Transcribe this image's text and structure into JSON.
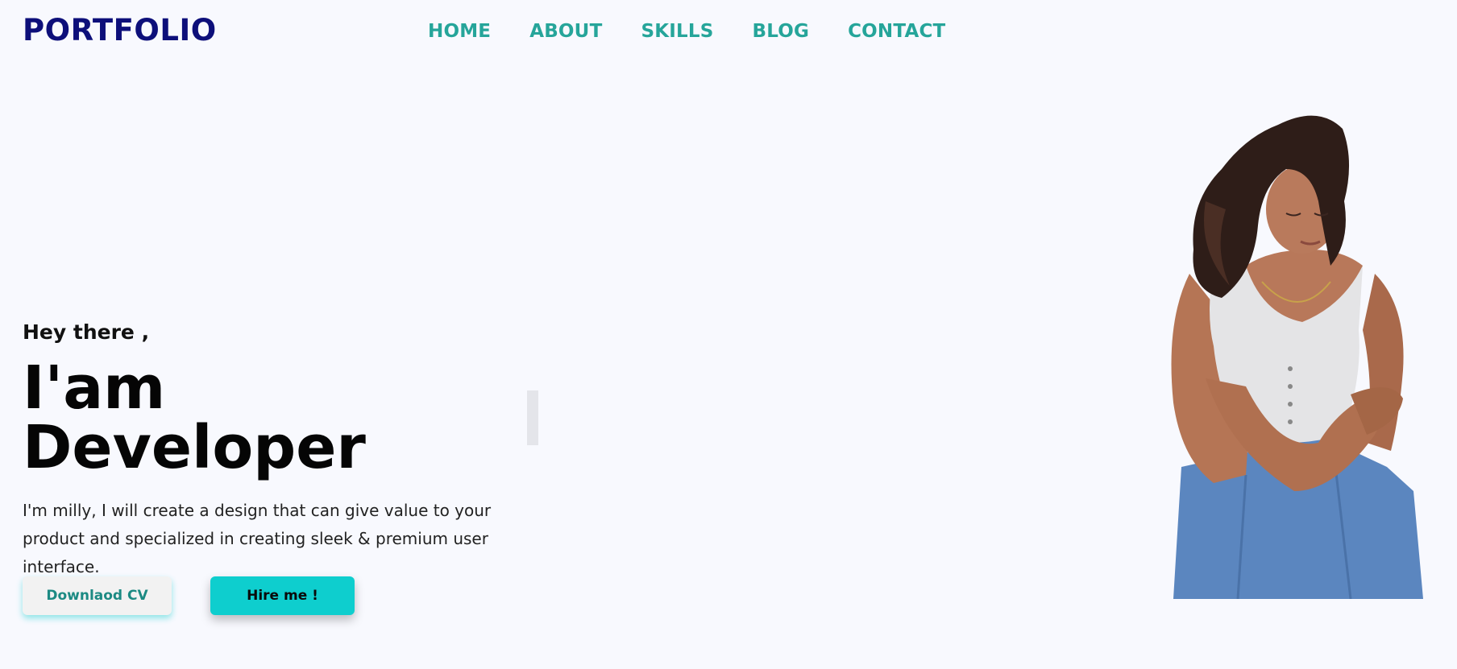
{
  "header": {
    "logo": "PORTFOLIO",
    "nav": [
      "HOME",
      "ABOUT",
      "SKILLS",
      "BLOG",
      "CONTACT"
    ]
  },
  "hero": {
    "greeting": "Hey there ,",
    "headline": "I'am Developer",
    "description": "I'm milly, I will create a design that can give value to your product and specialized in creating sleek & premium user interface.",
    "buttons": {
      "download_cv": "Downlaod CV",
      "hire_me": "Hire me !"
    }
  },
  "colors": {
    "background": "#f8f9fe",
    "logo": "#0d0f7a",
    "nav": "#26a59a",
    "accent": "#0ecece"
  },
  "image": {
    "subject": "woman-portrait"
  }
}
